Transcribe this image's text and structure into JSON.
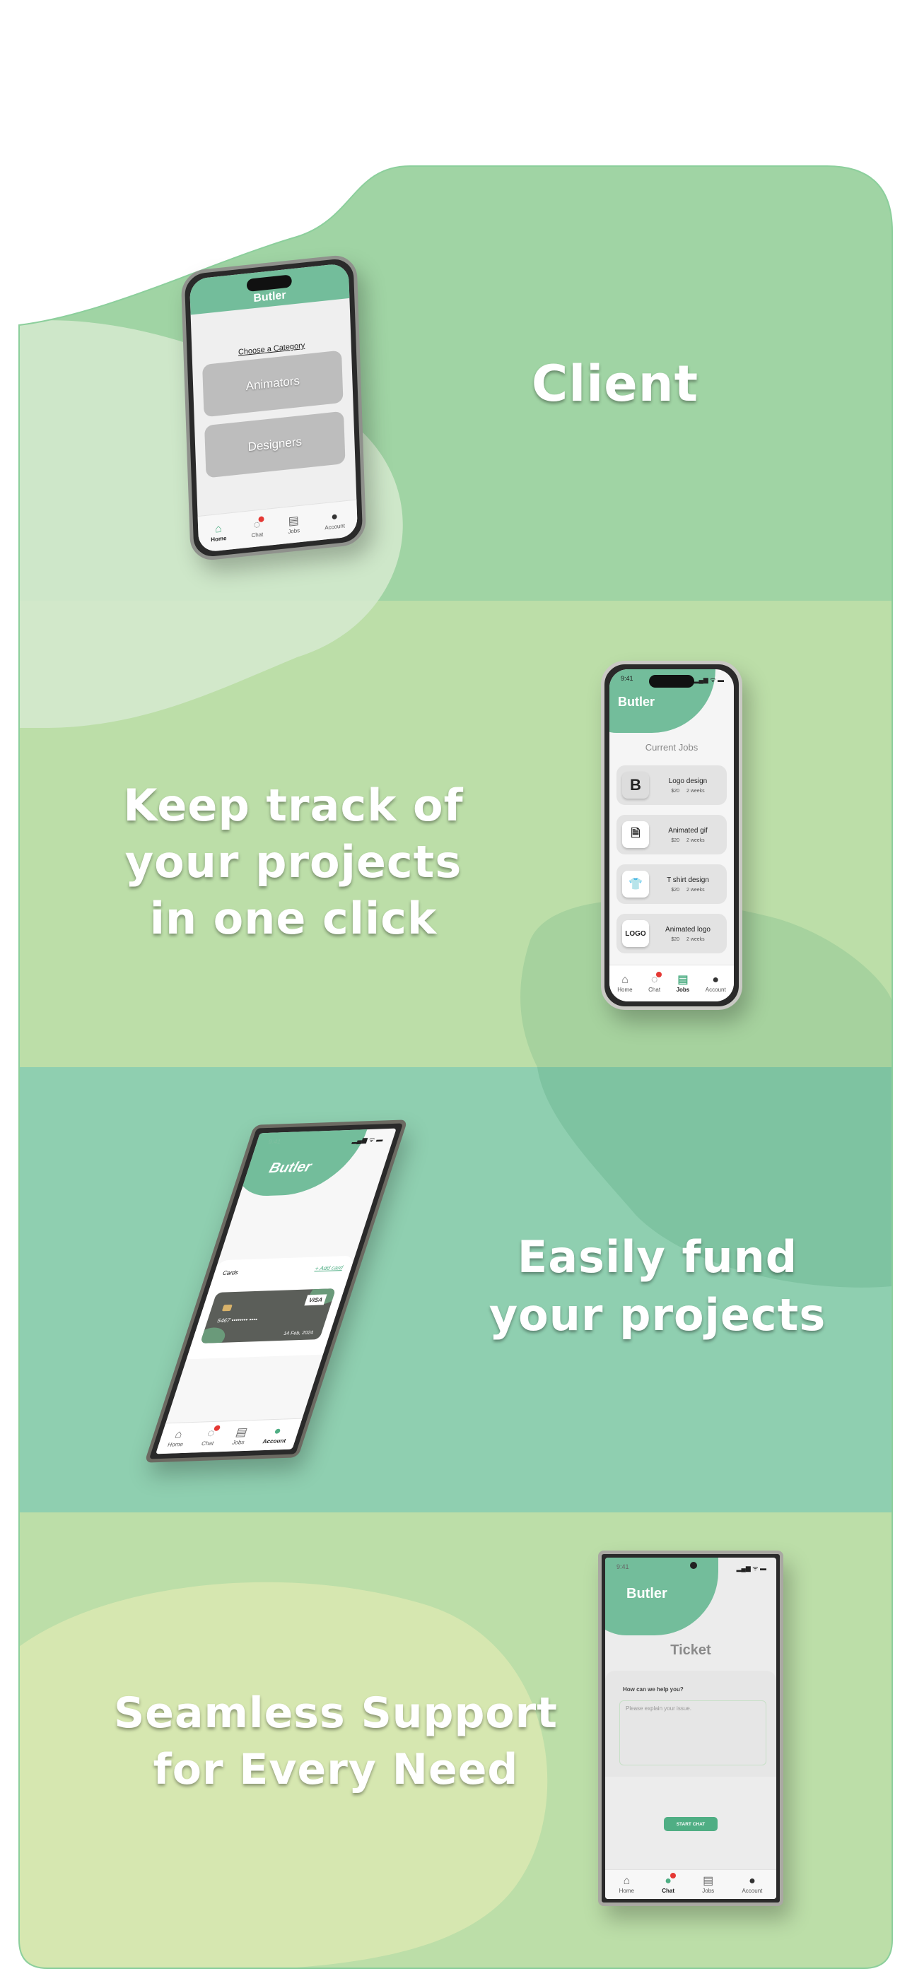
{
  "colors": {
    "section1": "#a0d4a4",
    "section2": "#bcdea8",
    "section3": "#8fcfb0",
    "section4": "#bcdea8",
    "accent": "#73bd9b"
  },
  "headlines": {
    "client": "Client",
    "track": [
      "Keep track of",
      "your projects",
      "in one click"
    ],
    "fund": [
      "Easily fund",
      "your projects"
    ],
    "support": [
      "Seamless Support",
      "for Every Need"
    ]
  },
  "status": {
    "time": "9:41",
    "signal": "▂▄▆ ᯤ ▬"
  },
  "brand": "Butler",
  "tabs": [
    {
      "label": "Home",
      "icon": "home-icon"
    },
    {
      "label": "Chat",
      "icon": "chat-icon"
    },
    {
      "label": "Jobs",
      "icon": "jobs-icon"
    },
    {
      "label": "Account",
      "icon": "account-icon"
    }
  ],
  "phone1": {
    "title": "Choose a Category",
    "categories": [
      "Animators",
      "Designers"
    ]
  },
  "phone2": {
    "title": "Current Jobs",
    "jobs": [
      {
        "name": "Logo design",
        "thumb": "B",
        "price": "$20",
        "duration": "2 weeks"
      },
      {
        "name": "Animated gif",
        "thumb": "🗎",
        "price": "$20",
        "duration": "2 weeks"
      },
      {
        "name": "T shirt design",
        "thumb": "👕",
        "price": "$20",
        "duration": "2 weeks"
      },
      {
        "name": "Animated logo",
        "thumb": "LOGO",
        "price": "$20",
        "duration": "2 weeks"
      }
    ]
  },
  "phone3": {
    "cards_label": "Cards",
    "add_card": "+ Add card",
    "card": {
      "number": "5467  •••••••• ••••",
      "date": "14 Feb, 2024",
      "brand": "VISA"
    }
  },
  "phone4": {
    "title": "Ticket",
    "question": "How can we help you?",
    "placeholder": "Please explain your issue.",
    "button": "START CHAT"
  }
}
